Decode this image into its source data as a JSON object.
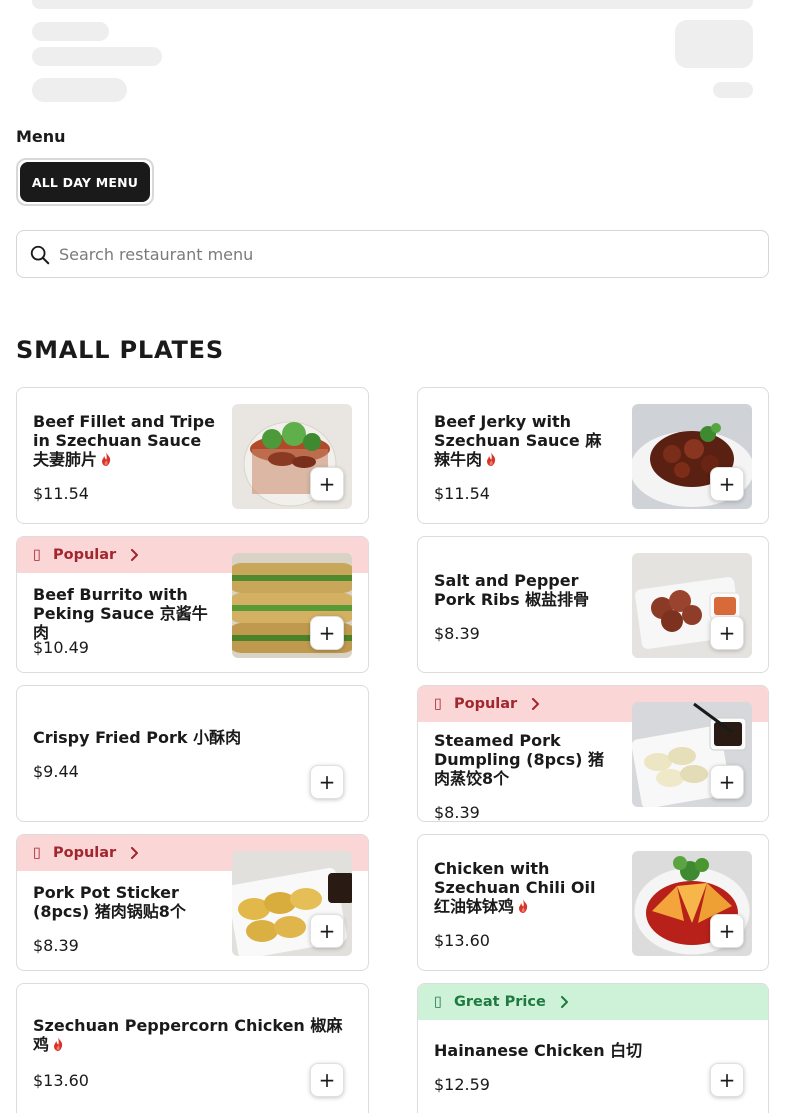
{
  "menu": {
    "label": "Menu",
    "tabs": [
      {
        "label": "ALL DAY MENU"
      }
    ]
  },
  "search": {
    "placeholder": "Search restaurant menu"
  },
  "section": {
    "title": "SMALL PLATES"
  },
  "badges": {
    "popular": "Popular",
    "great_price": "Great Price"
  },
  "colors": {
    "spicy": "#d9342b",
    "popular_bg": "#fbd6d6",
    "popular_fg": "#a2262e",
    "great_bg": "#cdf2d8",
    "great_fg": "#1f7a3f"
  },
  "items": [
    {
      "name": "Beef Fillet and Tripe in Szechuan Sauce 夫妻肺片",
      "price": "$11.54",
      "spicy": true,
      "badge": null,
      "image": "beef-fillet-tripe-photo"
    },
    {
      "name": "Beef Jerky with Szechuan Sauce 麻辣牛肉",
      "price": "$11.54",
      "spicy": true,
      "badge": null,
      "image": "beef-jerky-photo"
    },
    {
      "name": "Beef Burrito with Peking Sauce 京酱牛肉",
      "price": "$10.49",
      "spicy": false,
      "badge": "Popular",
      "image": "beef-burrito-photo"
    },
    {
      "name": "Salt and Pepper Pork Ribs 椒盐排骨",
      "price": "$8.39",
      "spicy": false,
      "badge": null,
      "image": "pork-ribs-photo"
    },
    {
      "name": "Crispy Fried Pork 小酥肉",
      "price": "$9.44",
      "spicy": false,
      "badge": null,
      "image": null
    },
    {
      "name": "Steamed Pork Dumpling (8pcs) 猪肉蒸饺8个",
      "price": "$8.39",
      "spicy": false,
      "badge": "Popular",
      "image": "steamed-dumpling-photo"
    },
    {
      "name": "Pork Pot Sticker (8pcs) 猪肉锅贴8个",
      "price": "$8.39",
      "spicy": false,
      "badge": "Popular",
      "image": "pot-sticker-photo"
    },
    {
      "name": "Chicken with Szechuan Chili Oil 红油钵钵鸡",
      "price": "$13.60",
      "spicy": true,
      "badge": null,
      "image": "chili-oil-chicken-photo"
    },
    {
      "name": "Szechuan Peppercorn Chicken 椒麻鸡",
      "price": "$13.60",
      "spicy": true,
      "badge": null,
      "image": null
    },
    {
      "name": "Hainanese Chicken 白切",
      "price": "$12.59",
      "spicy": false,
      "badge": "Great Price",
      "image": null
    }
  ],
  "icons": {
    "search": "search-icon",
    "add": "plus-icon",
    "flame": "flame-icon",
    "chevron": "chevron-right-icon",
    "badge_popular": "popular-icon",
    "badge_great": "great-price-icon"
  },
  "add_symbol": "+"
}
